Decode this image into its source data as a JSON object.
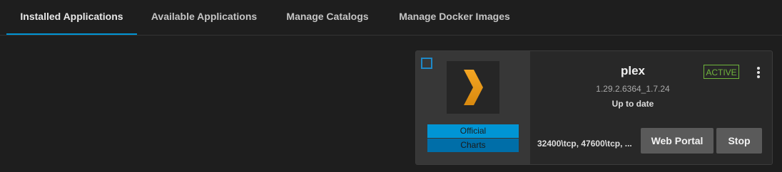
{
  "tabs": [
    {
      "label": "Installed Applications",
      "active": true
    },
    {
      "label": "Available Applications",
      "active": false
    },
    {
      "label": "Manage Catalogs",
      "active": false
    },
    {
      "label": "Manage Docker Images",
      "active": false
    }
  ],
  "app": {
    "name": "plex",
    "version": "1.29.2.6364_1.7.24",
    "update_status": "Up to date",
    "status": "ACTIVE",
    "ports": "32400\\tcp, 47600\\tcp, ...",
    "logo_icon": "plex-chevron-icon",
    "badges": [
      "Official",
      "Charts"
    ],
    "selected": false
  },
  "actions": {
    "portal_label": "Web Portal",
    "stop_label": "Stop",
    "menu_icon": "more-vert-icon"
  },
  "colors": {
    "background": "#1e1e1e",
    "accent": "#0095d5",
    "active_status": "#6fb53c",
    "button": "#5a5a5a"
  }
}
